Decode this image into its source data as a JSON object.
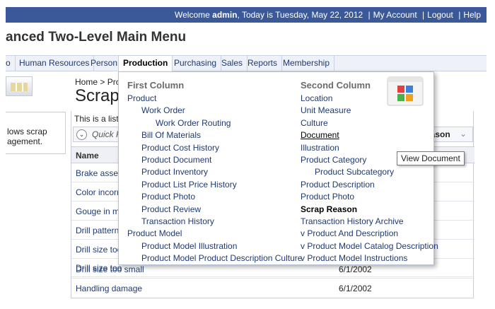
{
  "topbar": {
    "welcome_prefix": "Welcome",
    "user": "admin",
    "today_text": ", Today is Tuesday, May 22, 2012",
    "separator": "|",
    "links": [
      "My Account",
      "Logout",
      "Help"
    ]
  },
  "app_title": "anced Two-Level Main Menu",
  "menu": [
    "o",
    "Human Resources",
    "Person",
    "Production",
    "Purchasing",
    "Sales",
    "Reports",
    "Membership"
  ],
  "active_menu": "Production",
  "left_box_text": [
    "lows scrap",
    "agement."
  ],
  "breadcrumb": {
    "home": "Home",
    "sep": ">",
    "current": "Pro"
  },
  "page_title": "Scrap",
  "content": {
    "description": "This is a list",
    "quick_find": "Quick F",
    "reason_button": "eason",
    "column_name": "Name",
    "rows": [
      {
        "name": "Brake assem",
        "date": ""
      },
      {
        "name": "Color incorre",
        "date": ""
      },
      {
        "name": "Gouge in me",
        "date": ""
      },
      {
        "name": "Drill pattern",
        "date": ""
      },
      {
        "name": "Drill size too",
        "date": ""
      },
      {
        "name": "Drill size too",
        "date": ""
      },
      {
        "name": "Drill size too small",
        "date": "6/1/2002"
      },
      {
        "name": "Handling damage",
        "date": "6/1/2002"
      }
    ]
  },
  "dropdown": {
    "first_column": {
      "title": "First Column",
      "items": [
        {
          "label": "Product",
          "level": 0
        },
        {
          "label": "Work Order",
          "level": 1
        },
        {
          "label": "Work Order Routing",
          "level": 2
        },
        {
          "label": "Bill Of Materials",
          "level": 1
        },
        {
          "label": "Product Cost History",
          "level": 1
        },
        {
          "label": "Product Document",
          "level": 1
        },
        {
          "label": "Product Inventory",
          "level": 1
        },
        {
          "label": "Product List Price History",
          "level": 1
        },
        {
          "label": "Product Photo",
          "level": 1
        },
        {
          "label": "Product Review",
          "level": 1
        },
        {
          "label": "Transaction History",
          "level": 1
        },
        {
          "label": "Product Model",
          "level": 0
        },
        {
          "label": "Product Model Illustration",
          "level": 1
        },
        {
          "label": "Product Model Product Description Culture",
          "level": 1
        }
      ]
    },
    "second_column": {
      "title": "Second Column",
      "items": [
        {
          "label": "Location",
          "level": 0
        },
        {
          "label": "Unit Measure",
          "level": 0
        },
        {
          "label": "Culture",
          "level": 0
        },
        {
          "label": "Document",
          "level": 0,
          "state": "hover"
        },
        {
          "label": "Illustration",
          "level": 0
        },
        {
          "label": "Product Category",
          "level": 0
        },
        {
          "label": "Product Subcategory",
          "level": 1
        },
        {
          "label": "Product Description",
          "level": 0
        },
        {
          "label": "Product Photo",
          "level": 0
        },
        {
          "label": "Scrap Reason",
          "level": 0,
          "state": "current"
        },
        {
          "label": "Transaction History Archive",
          "level": 0
        },
        {
          "label": "v Product And Description",
          "level": 0
        },
        {
          "label": "v Product Model Catalog Description",
          "level": 0
        },
        {
          "label": "v Product Model Instructions",
          "level": 0
        }
      ]
    }
  },
  "tooltip": "View Document",
  "colors": {
    "topbar": "#3b5998",
    "link": "#1f3a73",
    "menubar": "#eef1f7"
  }
}
